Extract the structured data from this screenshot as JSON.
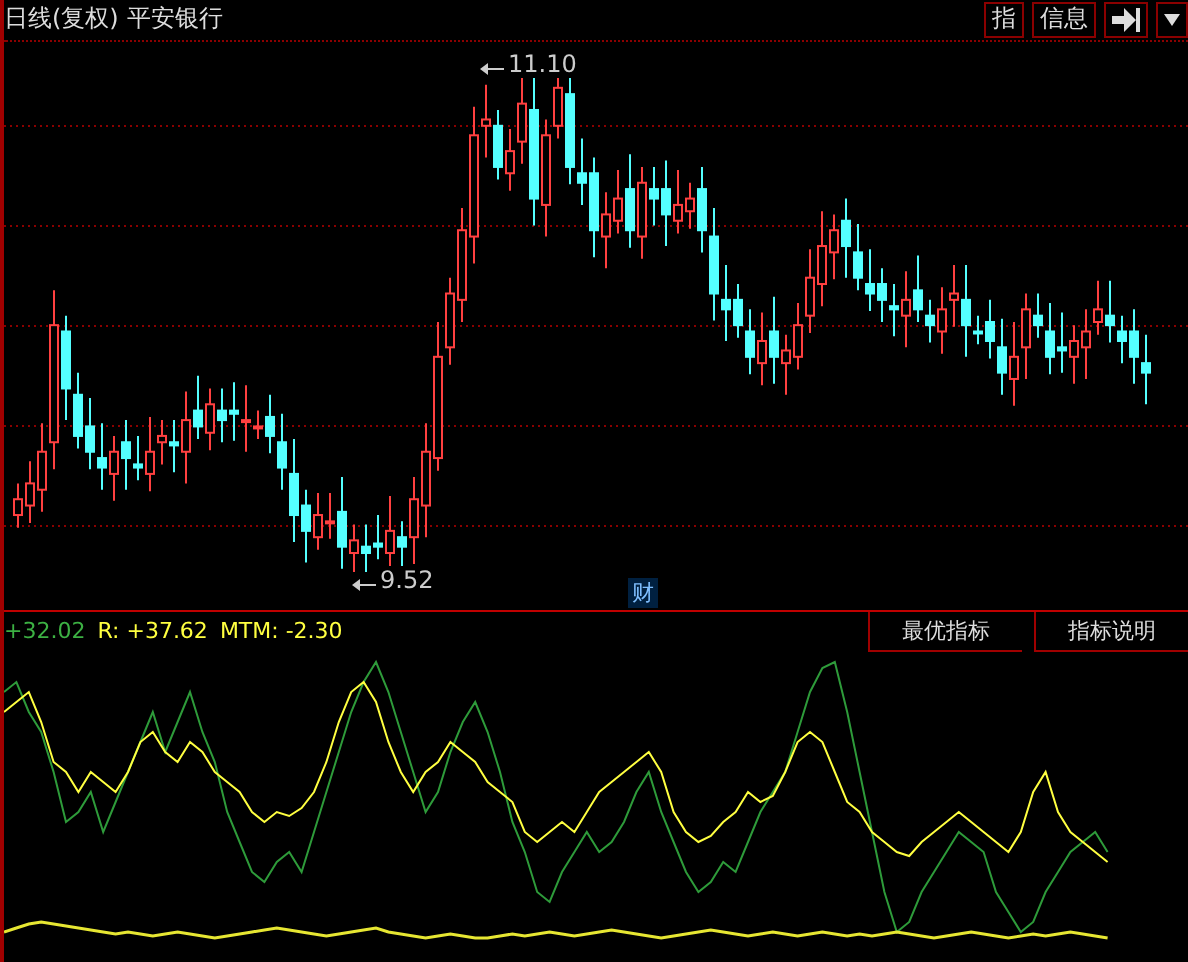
{
  "header": {
    "period": "日线(复权)",
    "stock_name": "平安银行",
    "buttons": [
      {
        "label": "指"
      },
      {
        "label": "信息"
      }
    ]
  },
  "price_chart": {
    "high_label": "11.10",
    "low_label": "9.52",
    "event_marker": "财"
  },
  "indicator": {
    "readings": [
      {
        "text": "+32.02",
        "color": "#3cb043"
      },
      {
        "text": "R: +37.62",
        "color": "#ffff40"
      },
      {
        "text": "MTM: -2.30",
        "color": "#ffff40"
      }
    ],
    "tabs": [
      {
        "label": "最优指标"
      },
      {
        "label": "指标说明"
      }
    ]
  }
}
